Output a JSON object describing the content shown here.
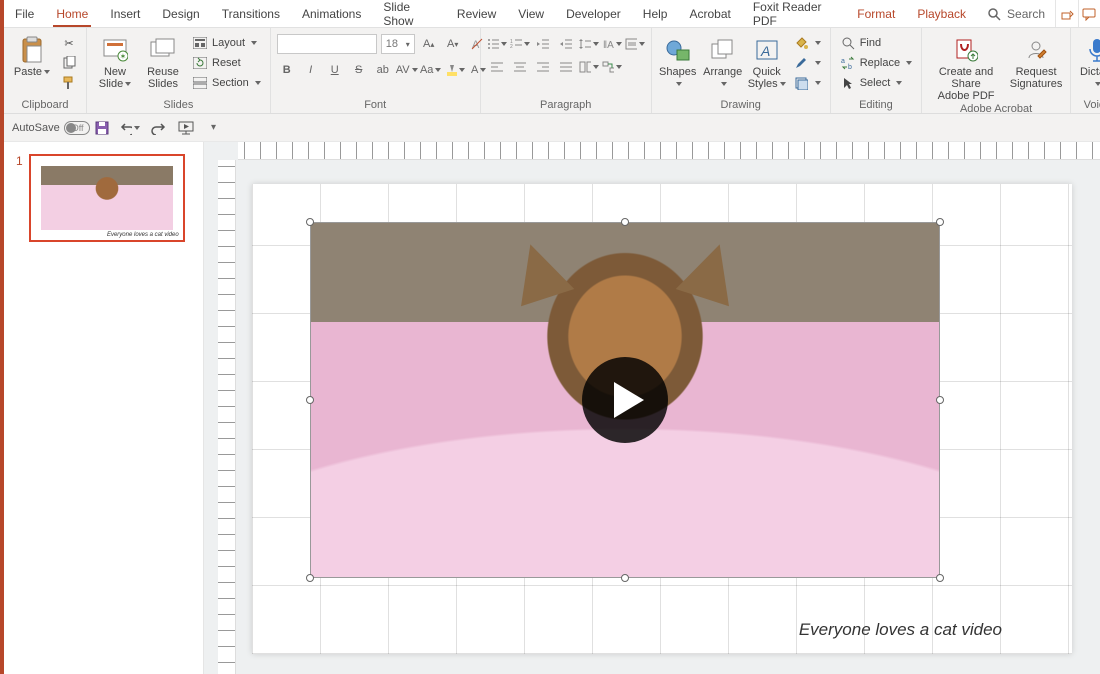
{
  "tabs": {
    "file": "File",
    "home": "Home",
    "insert": "Insert",
    "design": "Design",
    "transitions": "Transitions",
    "animations": "Animations",
    "slideshow": "Slide Show",
    "review": "Review",
    "view": "View",
    "developer": "Developer",
    "help": "Help",
    "acrobat": "Acrobat",
    "foxit": "Foxit Reader PDF",
    "format": "Format",
    "playback": "Playback",
    "search": "Search"
  },
  "ribbon": {
    "clipboard": {
      "label": "Clipboard",
      "paste": "Paste"
    },
    "slides": {
      "label": "Slides",
      "new": "New\nSlide",
      "reuse": "Reuse\nSlides",
      "layout": "Layout",
      "reset": "Reset",
      "section": "Section"
    },
    "font": {
      "label": "Font",
      "size": "18"
    },
    "paragraph": {
      "label": "Paragraph"
    },
    "drawing": {
      "label": "Drawing",
      "shapes": "Shapes",
      "arrange": "Arrange",
      "quick": "Quick\nStyles"
    },
    "editing": {
      "label": "Editing",
      "find": "Find",
      "replace": "Replace",
      "select": "Select"
    },
    "acrobat": {
      "label": "Adobe Acrobat",
      "create": "Create and Share\nAdobe PDF",
      "request": "Request\nSignatures"
    },
    "voice": {
      "label": "Voice",
      "dictate": "Dictate"
    }
  },
  "qat": {
    "autosave": "AutoSave",
    "off": "Off"
  },
  "thumb": {
    "num": "1",
    "caption": "Everyone loves a cat video"
  },
  "slide": {
    "caption": "Everyone loves a cat video"
  }
}
